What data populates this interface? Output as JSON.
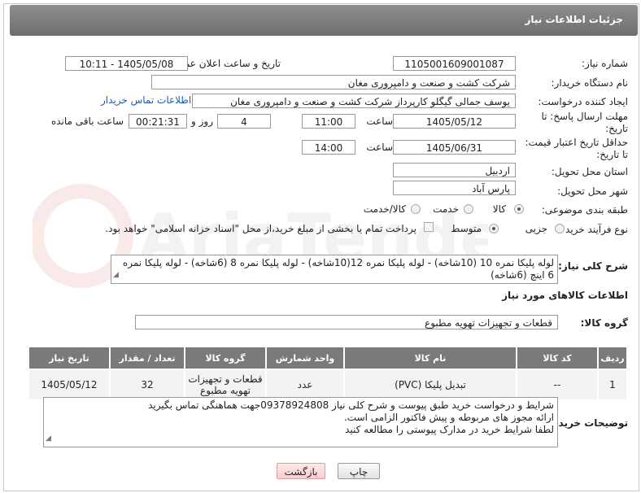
{
  "page": {
    "title": "جزئیات اطلاعات نیاز"
  },
  "labels": {
    "need_number": "شماره نیاز:",
    "announce_datetime": "تاریخ و ساعت اعلان عمومی:",
    "buyer_org": "نام دستگاه خریدار:",
    "requester": "ایجاد کننده درخواست:",
    "reply_deadline": "مهلت ارسال پاسخ: تا تاریخ:",
    "price_validity": "حداقل تاریخ اعتبار قیمت: تا تاریخ:",
    "time": "ساعت",
    "day_and": "روز و",
    "remaining": "ساعت باقی مانده",
    "province": "استان محل تحویل:",
    "city": "شهر محل تحویل:",
    "category": "طبقه بندی موضوعی:",
    "process_type": "نوع فرآیند خرید :",
    "general_desc": "شرح کلی نیاز:",
    "goods_info": "اطلاعات کالاهای مورد نیاز",
    "goods_group": "گروه کالا:",
    "buyer_notes": "توضیحات خریدار:"
  },
  "fields": {
    "need_number": "1105001609001087",
    "announce_datetime": "1405/05/08 - 10:11",
    "buyer_org": "شرکت کشت و صنعت و دامپروری مغان",
    "requester": "یوسف جمالی گیگلو کارپرداز شرکت کشت و صنعت و دامپروری مغان",
    "contact_link": "اطلاعات تماس خریدار",
    "reply_date": "1405/05/12",
    "reply_time": "11:00",
    "days_left": "4",
    "time_left": "00:21:31",
    "validity_date": "1405/06/31",
    "validity_time": "14:00",
    "province": "اردبیل",
    "city": "پارس آباد",
    "general_desc": "لوله پلیکا نمره 10 (10شاخه) - لوله پلیکا نمره 12(10شاخه) - لوله پلیکا نمره 8 (6شاخه) - لوله پلیکا نمره 6 اینچ (6شاخه)",
    "goods_group": "قطعات و تجهیزات تهویه مطبوع",
    "buyer_notes_1": "شرایط و درخواست خرید طبق پیوست و شرح کلی نیاز 09378924808جهت هماهنگی تماس بگیرید",
    "buyer_notes_2": "ارائه مجوز های مربوطه و پیش فاکتور الزامی است.",
    "buyer_notes_3": "لطفا شرایط خرید در مدارک پیوستی را مطالعه کنید"
  },
  "category_options": {
    "goods": "کالا",
    "service": "خدمت",
    "goods_service": "کالا/خدمت"
  },
  "process_options": {
    "partial": "جزیی",
    "medium": "متوسط",
    "payment_note": "پرداخت تمام یا بخشی از مبلغ خرید،از محل \"اسناد خزانه اسلامی\" خواهد بود."
  },
  "table": {
    "headers": [
      "ردیف",
      "کد کالا",
      "نام کالا",
      "واحد شمارش",
      "گروه کالا",
      "تعداد / مقدار",
      "تاریخ نیاز"
    ],
    "rows": [
      [
        "1",
        "--",
        "تبدیل پلیکا (PVC)",
        "عدد",
        "قطعات و تجهیزات تهویه مطبوع",
        "32",
        "1405/05/12"
      ]
    ]
  },
  "buttons": {
    "print": "چاپ",
    "back": "بازگشت"
  },
  "watermark": "AriaTender.net"
}
